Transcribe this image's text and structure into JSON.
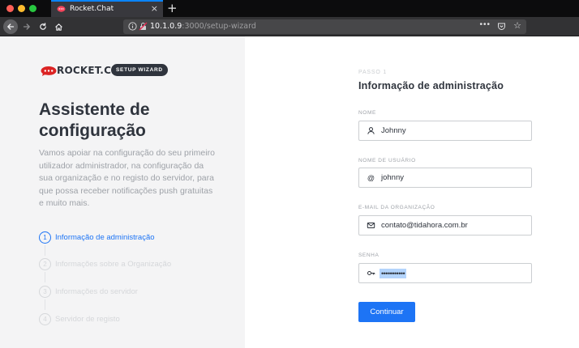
{
  "browser": {
    "tab_title": "Rocket.Chat",
    "tab_close": "×",
    "new_tab": "+",
    "url_host": "10.1.0.9",
    "url_rest": ":3000/setup-wizard",
    "url_actions": "•••"
  },
  "brand": {
    "name": "ROCKET.CHAT",
    "badge": "SETUP WIZARD"
  },
  "sidebar": {
    "title": "Assistente de configuração",
    "description": "Vamos apoiar na configuração do seu primeiro utilizador administrador, na configuração da sua organização e no registo do servidor, para que possa receber notificações push gratuitas e muito mais.",
    "steps": [
      {
        "num": "1",
        "label": "Informação de administração",
        "active": true
      },
      {
        "num": "2",
        "label": "Informações sobre a Organização",
        "active": false
      },
      {
        "num": "3",
        "label": "Informações do servidor",
        "active": false
      },
      {
        "num": "4",
        "label": "Servidor de registo",
        "active": false
      }
    ]
  },
  "form": {
    "kicker": "PASSO 1",
    "title": "Informação de administração",
    "fields": {
      "name": {
        "label": "NOME",
        "value": "Johnny",
        "icon": "user-icon"
      },
      "username": {
        "label": "NOME DE USUÁRIO",
        "value": "johnny",
        "icon": "at-icon"
      },
      "email": {
        "label": "E-MAIL DA ORGANIZAÇÃO",
        "value": "contato@tidahora.com.br",
        "icon": "mail-icon"
      },
      "password": {
        "label": "SENHA",
        "value": "•••••••••••",
        "icon": "key-icon"
      }
    },
    "submit_label": "Continuar"
  },
  "colors": {
    "accent": "#1d74f5",
    "brand_red": "#db2323",
    "sidebar_bg": "#f4f4f5",
    "text_dark": "#2f343d",
    "text_muted": "#9ea2a8"
  }
}
